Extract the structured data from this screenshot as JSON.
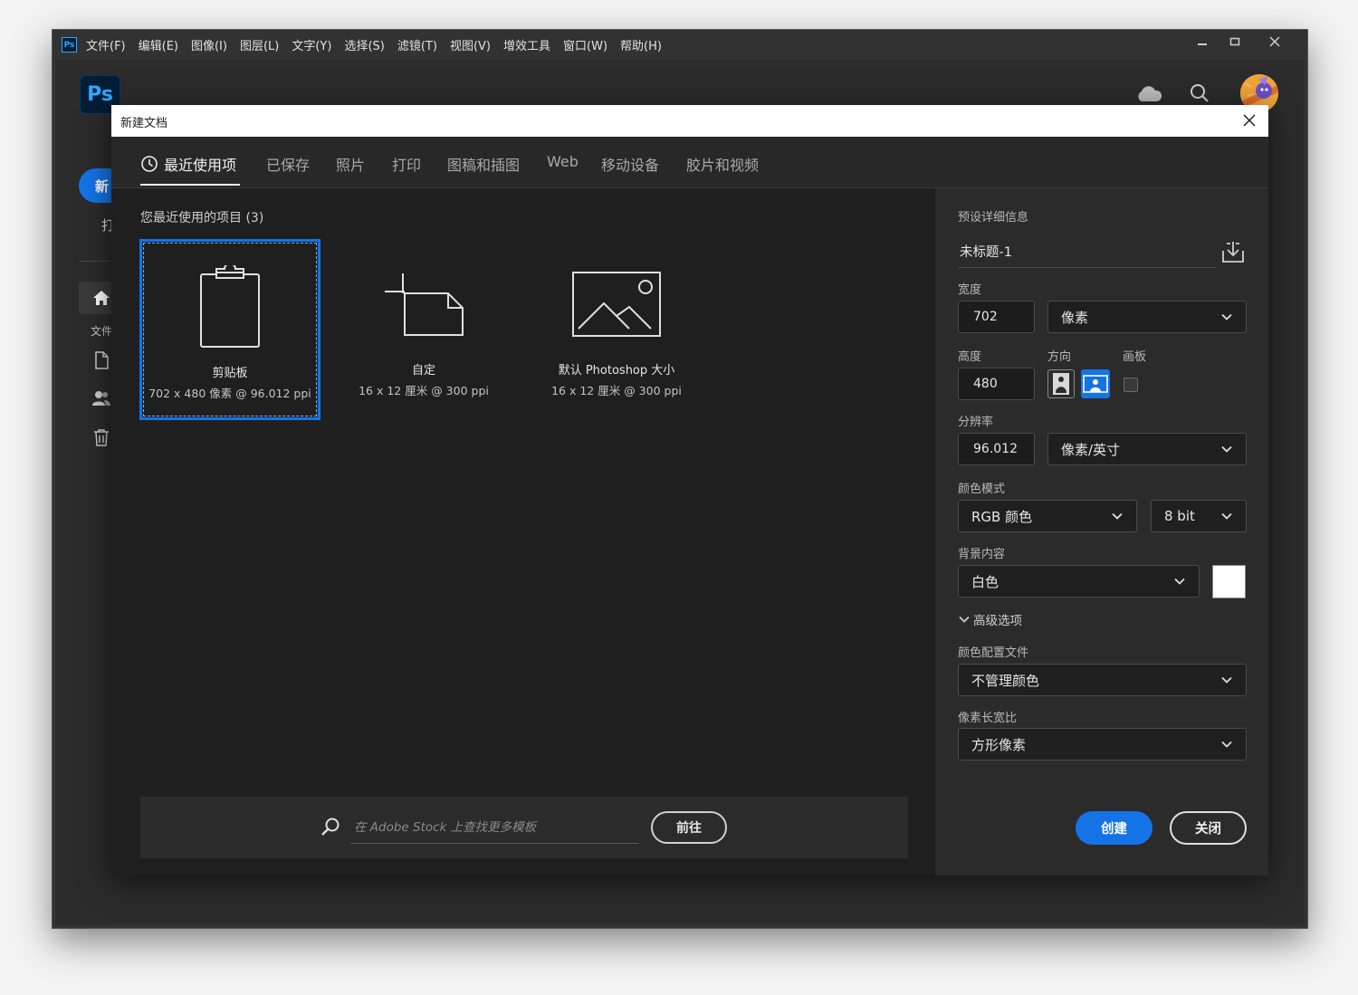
{
  "app": {
    "mini_logo": "Ps",
    "logo": "Ps",
    "menu": [
      "文件(F)",
      "编辑(E)",
      "图像(I)",
      "图层(L)",
      "文字(Y)",
      "选择(S)",
      "滤镜(T)",
      "视图(V)",
      "增效工具",
      "窗口(W)",
      "帮助(H)"
    ],
    "window_controls": [
      "minimize-icon",
      "maximize-icon",
      "close-icon"
    ],
    "top_icons": [
      "cloud-icon",
      "search-icon",
      "avatar"
    ]
  },
  "home": {
    "new_label": "新",
    "open_label": "打",
    "files_label": "文件",
    "side_icons": [
      "home-icon",
      "file-icon",
      "people-icon",
      "trash-icon"
    ]
  },
  "dialog": {
    "title": "新建文档",
    "tabs": [
      "最近使用项",
      "已保存",
      "照片",
      "打印",
      "图稿和插图",
      "Web",
      "移动设备",
      "胶片和视频"
    ],
    "active_tab": 0,
    "recent_title": "您最近使用的项目 (3)",
    "tiles": [
      {
        "name": "剪贴板",
        "sub": "702 x 480 像素 @ 96.012 ppi",
        "icon": "clipboard-icon",
        "selected": true
      },
      {
        "name": "自定",
        "sub": "16 x 12 厘米 @ 300 ppi",
        "icon": "custom-size-icon",
        "selected": false
      },
      {
        "name": "默认 Photoshop 大小",
        "sub": "16 x 12 厘米 @ 300 ppi",
        "icon": "image-icon",
        "selected": false
      }
    ],
    "search": {
      "placeholder": "在 Adobe Stock 上查找更多模板",
      "go": "前往"
    },
    "preset": {
      "section_title": "预设详细信息",
      "name": "未标题-1",
      "width_label": "宽度",
      "width_value": "702",
      "width_unit": "像素",
      "height_label": "高度",
      "height_value": "480",
      "orientation_label": "方向",
      "artboard_label": "画板",
      "orientation_selected": "landscape",
      "resolution_label": "分辨率",
      "resolution_value": "96.012",
      "resolution_unit": "像素/英寸",
      "color_mode_label": "颜色模式",
      "color_mode": "RGB 颜色",
      "bit_depth": "8 bit",
      "background_label": "背景内容",
      "background": "白色",
      "background_color": "#ffffff",
      "advanced_label": "高级选项",
      "color_profile_label": "颜色配置文件",
      "color_profile": "不管理颜色",
      "pixel_aspect_label": "像素长宽比",
      "pixel_aspect": "方形像素"
    },
    "buttons": {
      "create": "创建",
      "close": "关闭"
    }
  },
  "colors": {
    "accent": "#1473e6",
    "dialog_bg": "#1f1f1f",
    "panel_bg": "#2b2b2b"
  }
}
